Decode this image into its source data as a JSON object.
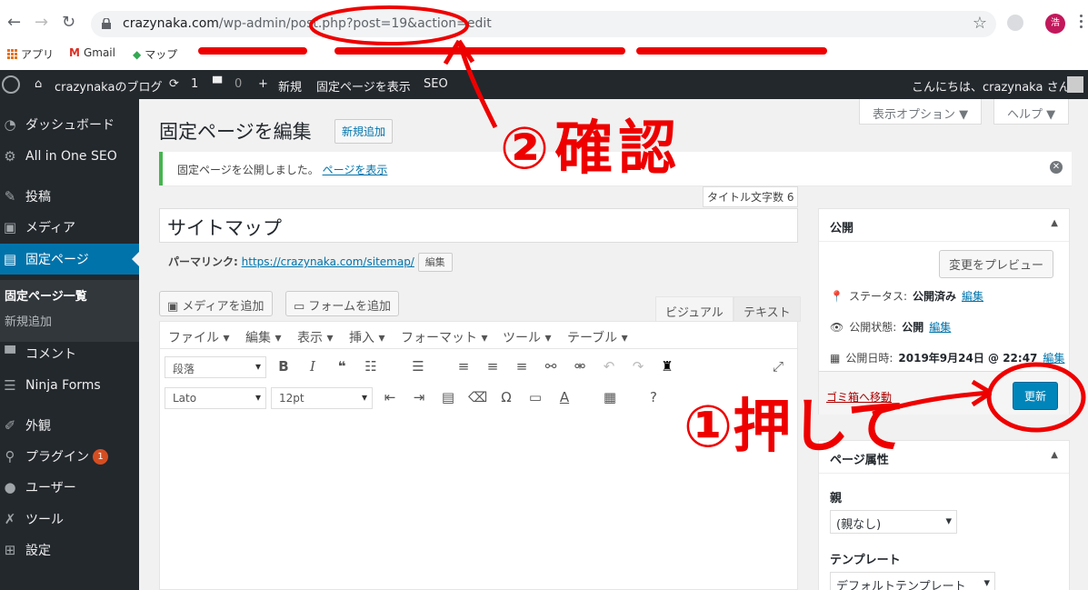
{
  "browser": {
    "url_host": "crazynaka.com",
    "url_path": "/wp-admin/post.php",
    "url_query": "?post=19&action=edit",
    "avatar_letter": "浩",
    "bookmarks": [
      "アプリ",
      "Gmail",
      "マップ"
    ]
  },
  "adminbar": {
    "site_name": "crazynakaのブログ",
    "updates": "1",
    "comments": "0",
    "new": "新規",
    "view_page": "固定ページを表示",
    "seo": "SEO",
    "greeting": "こんにちは、crazynaka さん"
  },
  "sidebar": {
    "items": [
      {
        "label": "ダッシュボード",
        "icon": "dashboard-icon"
      },
      {
        "label": "All in One SEO",
        "icon": "gear-icon"
      },
      {
        "label": "投稿",
        "icon": "pin-icon"
      },
      {
        "label": "メディア",
        "icon": "media-icon"
      },
      {
        "label": "固定ページ",
        "icon": "page-icon"
      },
      {
        "label": "コメント",
        "icon": "comment-icon"
      },
      {
        "label": "Ninja Forms",
        "icon": "forms-icon"
      },
      {
        "label": "外観",
        "icon": "brush-icon"
      },
      {
        "label": "プラグイン",
        "icon": "plugin-icon",
        "badge": "1"
      },
      {
        "label": "ユーザー",
        "icon": "user-icon"
      },
      {
        "label": "ツール",
        "icon": "wrench-icon"
      },
      {
        "label": "設定",
        "icon": "settings-icon"
      }
    ],
    "sub": [
      "固定ページ一覧",
      "新規追加"
    ]
  },
  "main": {
    "screen_options": "表示オプション ▼",
    "help": "ヘルプ ▼",
    "title": "固定ページを編集",
    "add_new": "新規追加",
    "notice": "固定ページを公開しました。",
    "notice_link": "ページを表示",
    "title_count": "タイトル文字数 6",
    "post_title": "サイトマップ",
    "permalink_label": "パーマリンク:",
    "permalink_url": "https://crazynaka.com/sitemap/",
    "permalink_edit": "編集",
    "add_media": "メディアを追加",
    "add_form": "フォームを追加",
    "tab_visual": "ビジュアル",
    "tab_text": "テキスト",
    "menus": [
      "ファイル ▾",
      "編集 ▾",
      "表示 ▾",
      "挿入 ▾",
      "フォーマット ▾",
      "ツール ▾",
      "テーブル ▾"
    ],
    "format_select": "段落",
    "font_select": "Lato",
    "size_select": "12pt"
  },
  "publish": {
    "title": "公開",
    "preview": "変更をプレビュー",
    "status_label": "ステータス:",
    "status_value": "公開済み",
    "visibility_label": "公開状態:",
    "visibility_value": "公開",
    "date_label": "公開日時:",
    "date_value": "2019年9月24日 @ 22:47",
    "edit": "編集",
    "trash": "ゴミ箱へ移動",
    "update": "更新"
  },
  "attributes": {
    "title": "ページ属性",
    "parent_label": "親",
    "parent_value": "(親なし)",
    "template_label": "テンプレート",
    "template_value": "デフォルトテンプレート"
  },
  "annotations": {
    "confirm": "②確認",
    "press": "①押して"
  },
  "colors": {
    "accent": "#0073aa",
    "annotation": "#e00000",
    "adminbar": "#23282d"
  }
}
